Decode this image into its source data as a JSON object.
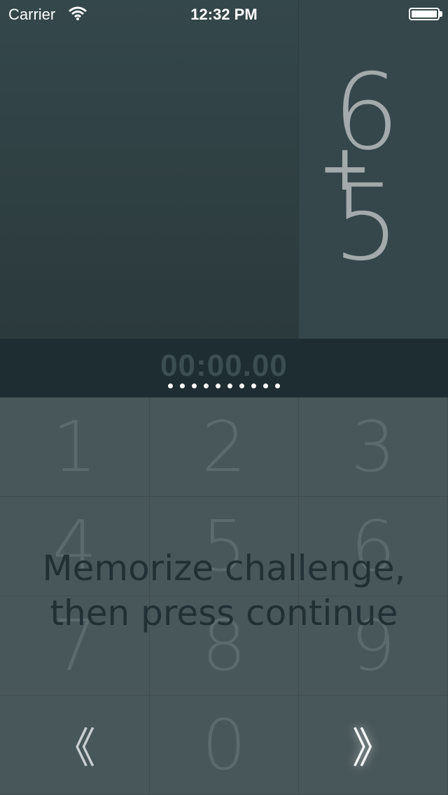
{
  "status_bar": {
    "carrier": "Carrier",
    "time": "12:32 PM",
    "wifi_icon": "wifi-icon",
    "battery_icon": "battery-icon"
  },
  "problem": {
    "operand_top": "6",
    "operator": "+",
    "operand_bottom": "5"
  },
  "timer": {
    "value": "00:00.00",
    "progress_dots": 10
  },
  "keypad": {
    "keys": [
      "1",
      "2",
      "3",
      "4",
      "5",
      "6",
      "7",
      "8",
      "9"
    ],
    "zero": "0",
    "back_label": "《",
    "continue_label": "》",
    "back_icon": "double-chevron-left-icon",
    "continue_icon": "double-chevron-right-icon"
  },
  "overlay": {
    "line1": "Memorize challenge,",
    "line2": "then press continue"
  },
  "colors": {
    "background": "#48575a",
    "timer_bar": "#1e2d31",
    "overlay_text": "#213034",
    "operand_text": "#a3aaab"
  }
}
